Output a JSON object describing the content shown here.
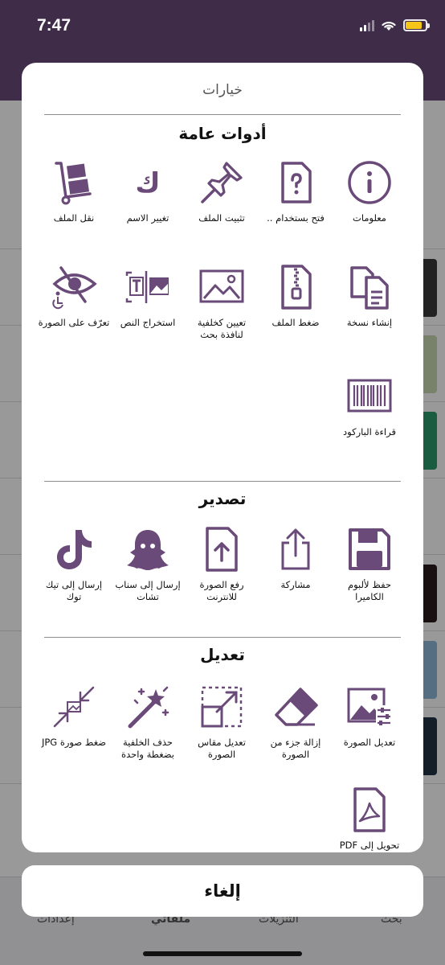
{
  "status_bar": {
    "time": "7:47"
  },
  "sheet": {
    "title": "خيارات",
    "sections": [
      {
        "title": "أدوات عامة",
        "items": [
          {
            "label": "معلومات",
            "icon": "info-icon"
          },
          {
            "label": "فتح بستخدام ..",
            "icon": "open-with-icon"
          },
          {
            "label": "تثبيت الملف",
            "icon": "pin-icon"
          },
          {
            "label": "تغيير الاسم",
            "icon": "rename-icon"
          },
          {
            "label": "نقل الملف",
            "icon": "move-file-icon"
          },
          {
            "label": "إنشاء نسخة",
            "icon": "duplicate-icon"
          },
          {
            "label": "ضغط الملف",
            "icon": "zip-icon"
          },
          {
            "label": "تعيين كخلفية لنافذة بحث",
            "icon": "wallpaper-icon"
          },
          {
            "label": "استخراج النص",
            "icon": "extract-text-icon"
          },
          {
            "label": "تعرّف على الصورة",
            "icon": "image-recognition-icon"
          },
          {
            "label": "قراءة الباركود",
            "icon": "barcode-icon"
          }
        ]
      },
      {
        "title": "تصدير",
        "items": [
          {
            "label": "حفظ لألبوم الكاميرا",
            "icon": "save-icon"
          },
          {
            "label": "مشاركة",
            "icon": "share-icon"
          },
          {
            "label": "رفع الصورة للانترنت",
            "icon": "upload-icon"
          },
          {
            "label": "إرسال إلى سناب تشات",
            "icon": "snapchat-icon"
          },
          {
            "label": "إرسال إلى تيك توك",
            "icon": "tiktok-icon"
          }
        ]
      },
      {
        "title": "تعديل",
        "items": [
          {
            "label": "تعديل الصورة",
            "icon": "edit-image-icon"
          },
          {
            "label": "إزالة جزء من الصورة",
            "icon": "eraser-icon"
          },
          {
            "label": "تعديل مقاس الصورة",
            "icon": "resize-icon"
          },
          {
            "label": "حذف الخلفية بضغطة واحدة",
            "icon": "magic-wand-icon"
          },
          {
            "label": "ضغط صورة JPG",
            "icon": "compress-image-icon"
          },
          {
            "label": "تحويل إلى PDF",
            "icon": "pdf-icon"
          }
        ]
      }
    ]
  },
  "cancel_label": "إلغاء",
  "background": {
    "tabs": [
      "إعدادات",
      "ملفاتي",
      "التنزيلات",
      "بحث"
    ]
  },
  "colors": {
    "accent": "#6a4a78",
    "header": "#6a4a78"
  }
}
